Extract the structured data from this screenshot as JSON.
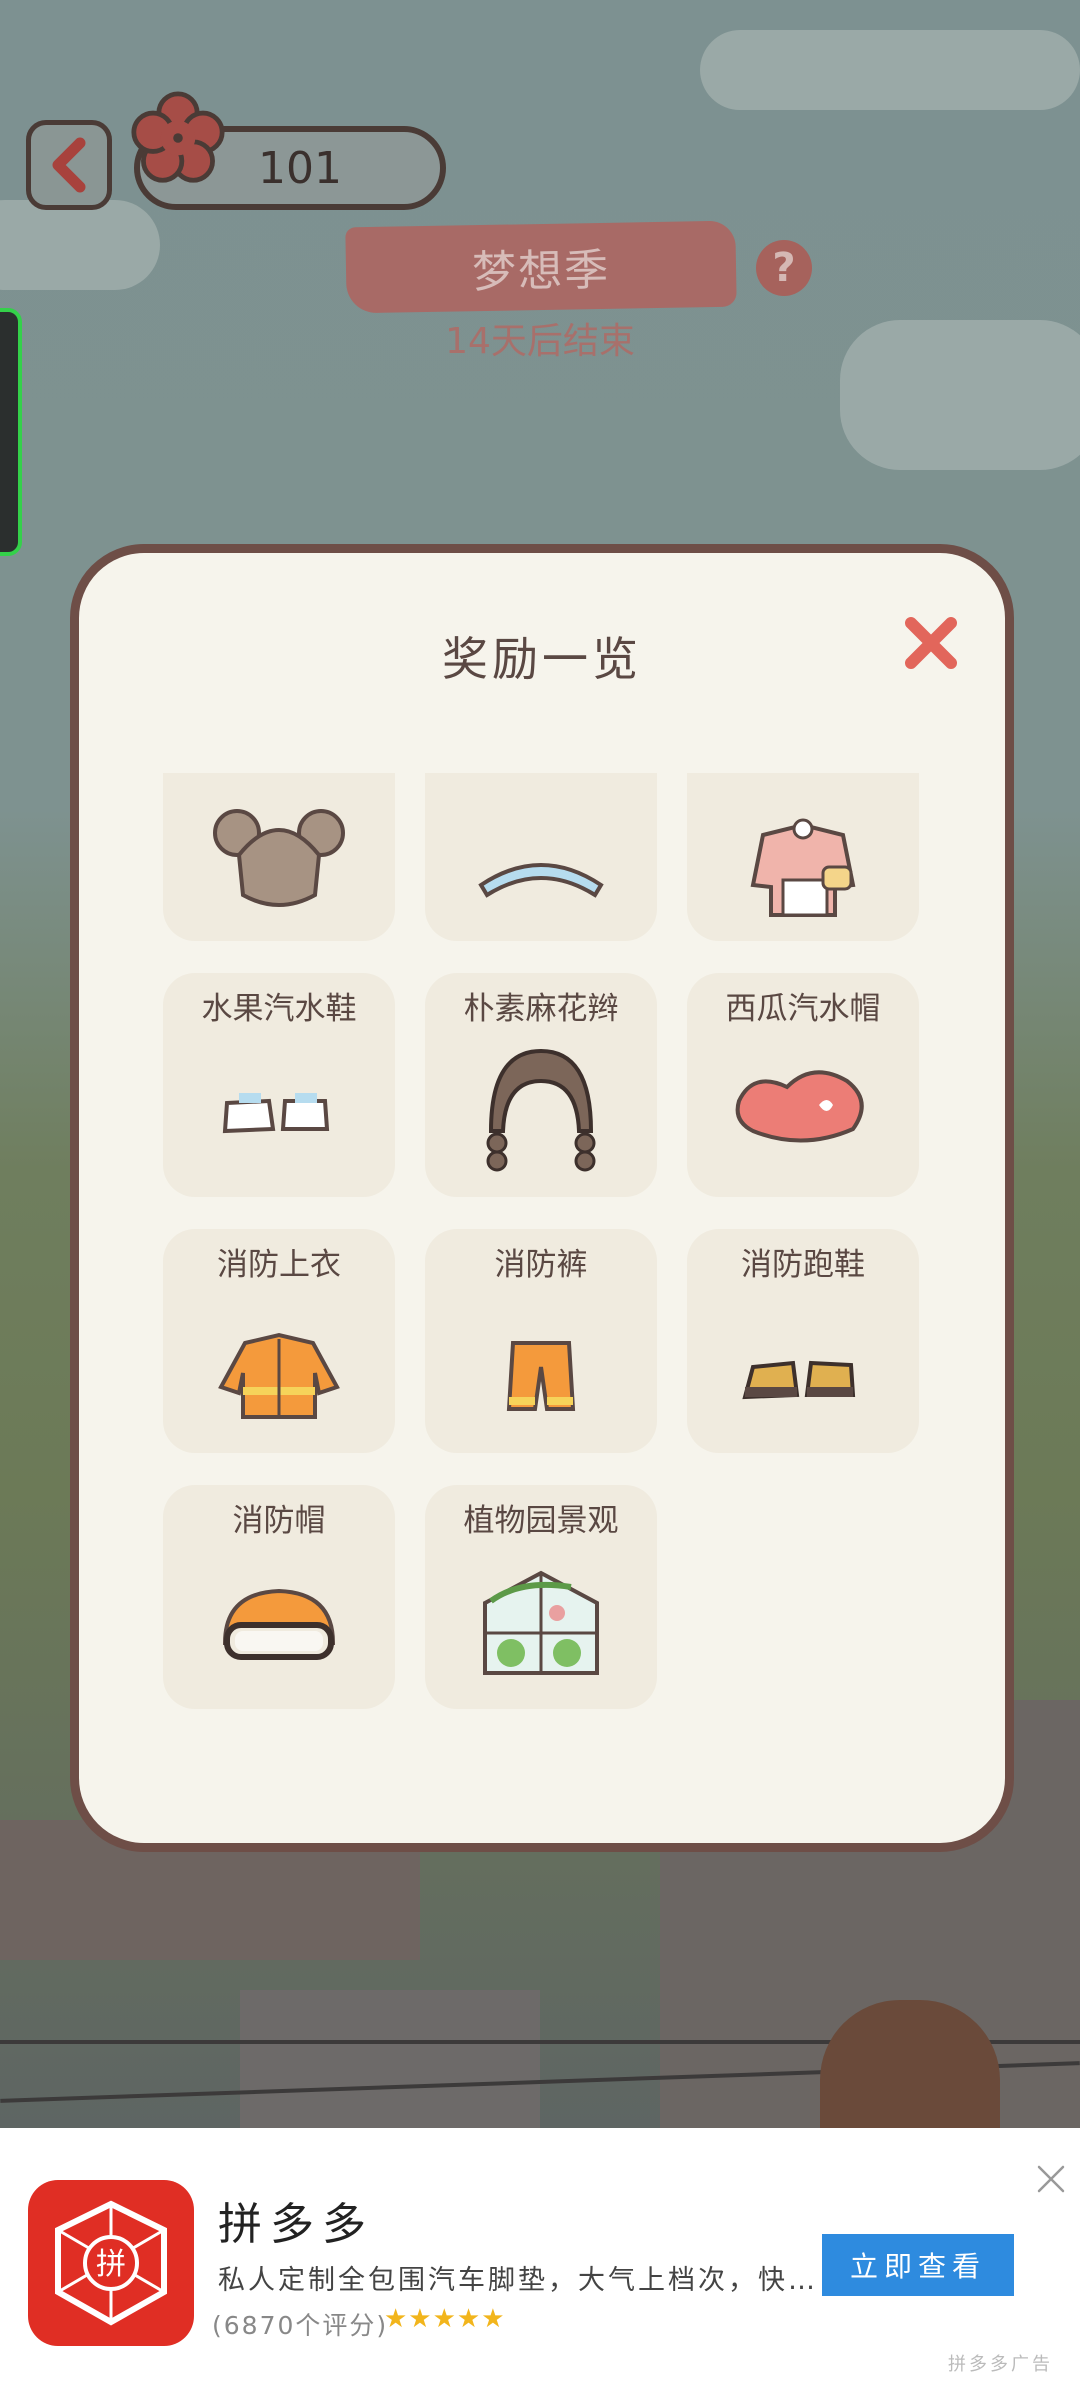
{
  "header": {
    "back_icon": "chevron-left-icon",
    "currency_icon": "flower-icon",
    "coin_count": "101",
    "season_title": "梦想季",
    "season_subtitle": "14天后结束",
    "help_label": "?"
  },
  "modal": {
    "title": "奖励一览",
    "close_icon": "close-icon",
    "items": [
      {
        "label": "",
        "icon": "twin-buns-hair-icon"
      },
      {
        "label": "",
        "icon": "blue-headband-icon"
      },
      {
        "label": "",
        "icon": "outfit-with-bag-icon"
      },
      {
        "label": "水果汽水鞋",
        "icon": "white-sneakers-icon"
      },
      {
        "label": "朴素麻花辫",
        "icon": "braided-hair-icon"
      },
      {
        "label": "西瓜汽水帽",
        "icon": "pink-hat-icon"
      },
      {
        "label": "消防上衣",
        "icon": "fire-jacket-icon"
      },
      {
        "label": "消防裤",
        "icon": "fire-pants-icon"
      },
      {
        "label": "消防跑鞋",
        "icon": "fire-boots-icon"
      },
      {
        "label": "消防帽",
        "icon": "fire-helmet-icon"
      },
      {
        "label": "植物园景观",
        "icon": "greenhouse-icon"
      }
    ]
  },
  "ad": {
    "app_name": "拼多多",
    "description": "私人定制全包围汽车脚垫，大气上档次，快...",
    "rating_text": "(6870个评分)",
    "stars": "★★★★★",
    "cta_label": "立即查看",
    "tag": "拼多多广告",
    "logo_glyph": "拼"
  },
  "colors": {
    "accent": "#e02e24",
    "cta": "#2e8bdf",
    "modal_border": "#6e4e47",
    "modal_bg": "#f6f4ec",
    "card_bg": "#f0ebdf"
  }
}
